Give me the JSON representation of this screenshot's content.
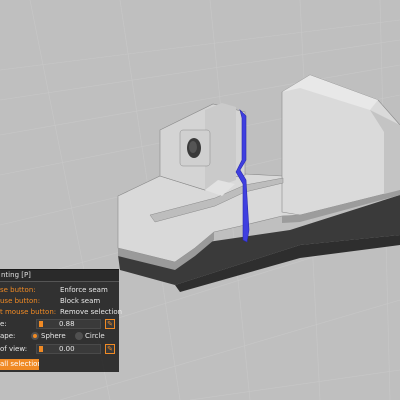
{
  "panel": {
    "title": "nting [P]",
    "rows": [
      {
        "label": "se button:",
        "value": "Enforce seam"
      },
      {
        "label": "use button:",
        "value": "Block seam"
      },
      {
        "label": "t mouse button:",
        "value": "Remove selection"
      }
    ],
    "brush_label": "e:",
    "brush_value": "0.88",
    "shape_label": "ape:",
    "shape_options": [
      "Sphere",
      "Circle"
    ],
    "shape_selected": "Sphere",
    "view_label": "of view:",
    "view_value": "0.00",
    "clear_label": "all selection"
  },
  "colors": {
    "background": "#bfbfbf",
    "accent": "#f08a24",
    "seam": "#3f3fe0",
    "panel_bg": "#282828"
  },
  "icons": [
    "pen-icon",
    "pen-icon"
  ]
}
